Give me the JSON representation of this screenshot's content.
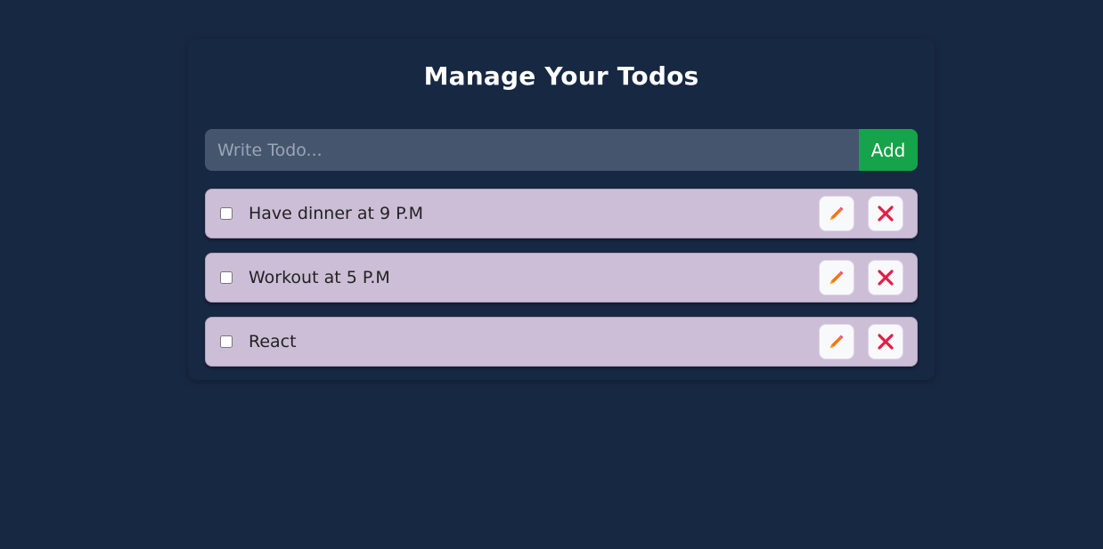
{
  "header": {
    "title": "Manage Your Todos"
  },
  "add_form": {
    "placeholder": "Write Todo...",
    "value": "",
    "add_label": "Add"
  },
  "todos": [
    {
      "text": "Have dinner at 9 P.M",
      "completed": false,
      "edit_icon": "pencil-icon",
      "delete_icon": "close-icon"
    },
    {
      "text": "Workout at 5 P.M",
      "completed": false,
      "edit_icon": "pencil-icon",
      "delete_icon": "close-icon"
    },
    {
      "text": "React",
      "completed": false,
      "edit_icon": "pencil-icon",
      "delete_icon": "close-icon"
    }
  ],
  "colors": {
    "background": "#172842",
    "input_bg": "#45556d",
    "add_button": "#16a34a",
    "todo_bg": "#ccbed7",
    "edit_icon": "#f97316",
    "delete_icon": "#e11d48"
  }
}
